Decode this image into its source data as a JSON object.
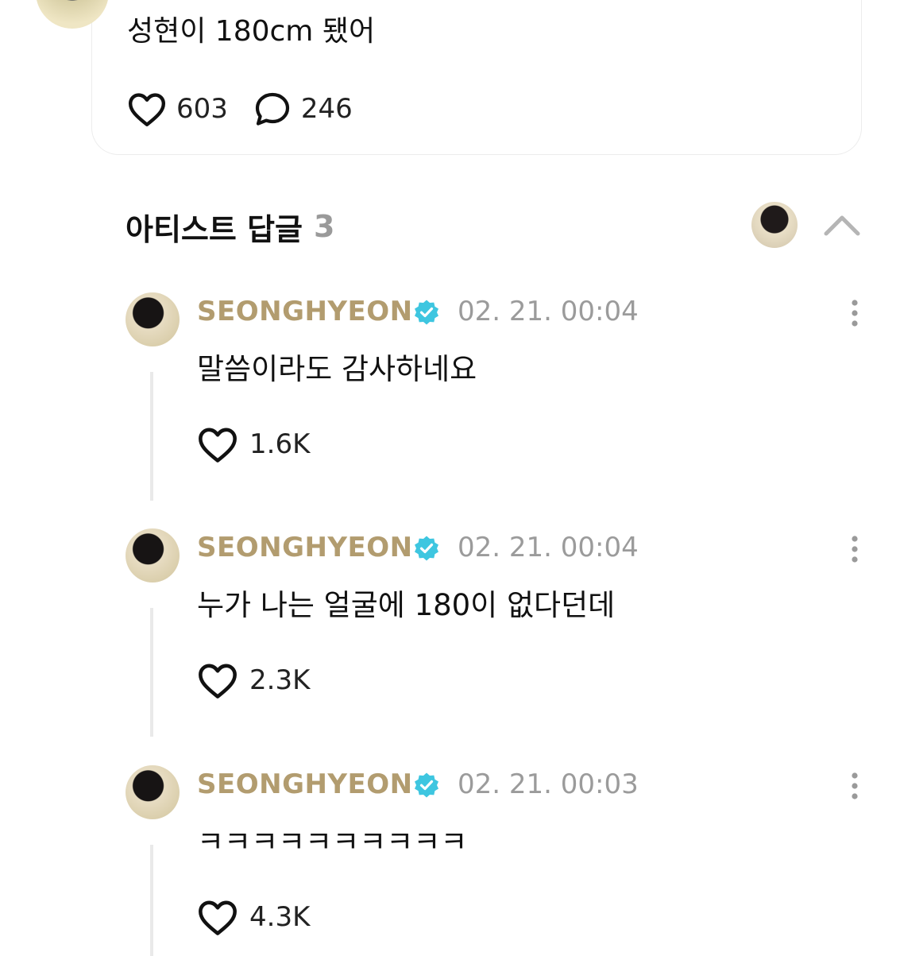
{
  "post": {
    "text": "성현이 180cm 됐어",
    "likes": "603",
    "comments": "246"
  },
  "artist_replies": {
    "title": "아티스트 답글",
    "count": "3",
    "replies": [
      {
        "name": "SEONGHYEON",
        "time": "02. 21. 00:04",
        "text": "말씀이라도 감사하네요",
        "likes": "1.6K"
      },
      {
        "name": "SEONGHYEON",
        "time": "02. 21. 00:04",
        "text": "누가 나는 얼굴에 180이 없다던데",
        "likes": "2.3K"
      },
      {
        "name": "SEONGHYEON",
        "time": "02. 21. 00:03",
        "text": "ㅋㅋㅋㅋㅋㅋㅋㅋㅋㅋ",
        "likes": "4.3K"
      }
    ]
  },
  "colors": {
    "artist_name": "#b29c6f",
    "verified_badge": "#3ec6e0",
    "timestamp": "#9b9b9b",
    "count": "#9a9a9a"
  },
  "icons": {
    "like": "heart-icon",
    "comment": "speech-bubble-icon",
    "verified": "verified-badge-icon",
    "more": "vertical-dots-icon",
    "collapse": "chevron-up-icon"
  }
}
